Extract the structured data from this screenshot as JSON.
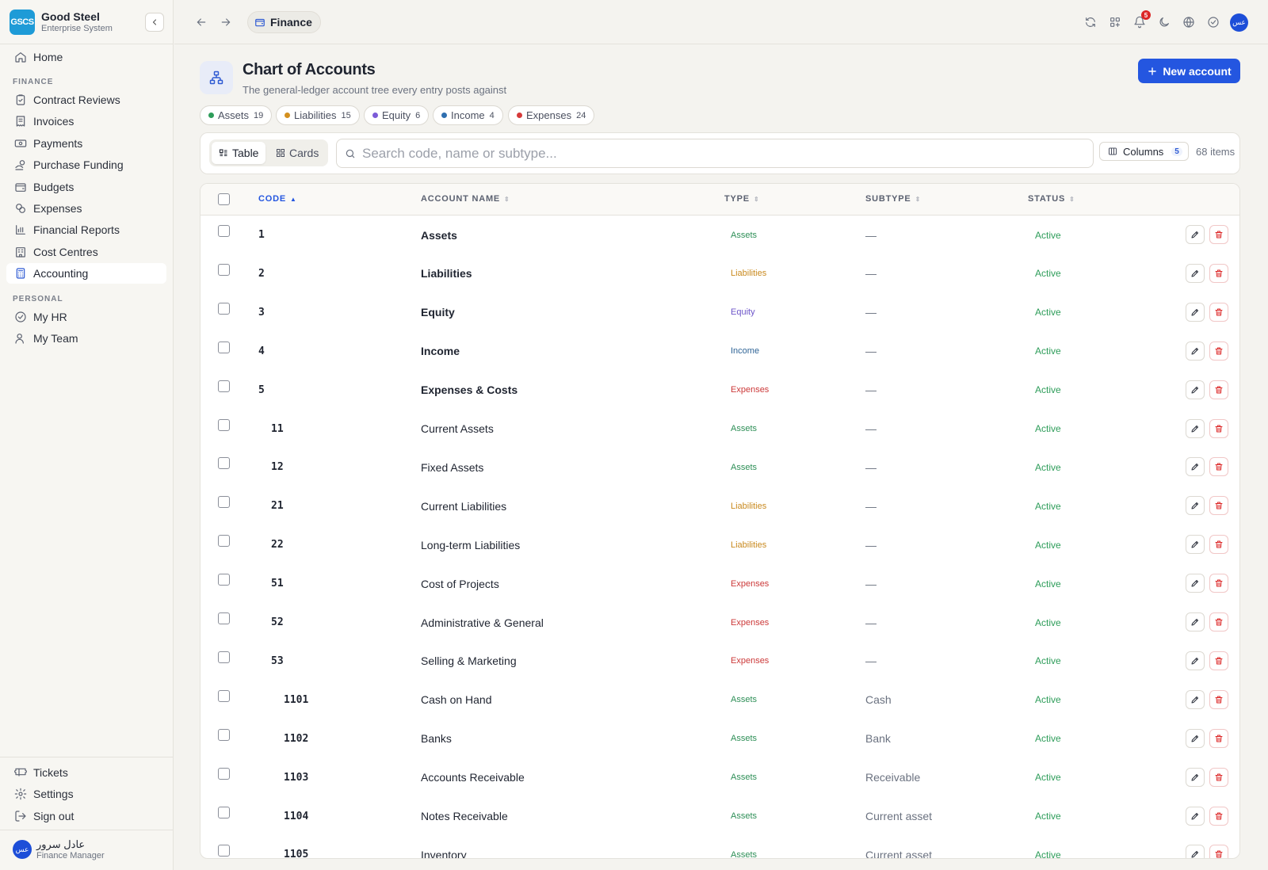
{
  "brand": {
    "logo": "GSCS",
    "name": "Good Steel",
    "subtitle": "Enterprise System"
  },
  "sidebar": {
    "home": "Home",
    "finance_section": "FINANCE",
    "finance_items": [
      {
        "label": "Contract Reviews",
        "icon": "clipboard-check-icon"
      },
      {
        "label": "Invoices",
        "icon": "receipt-icon"
      },
      {
        "label": "Payments",
        "icon": "banknote-icon"
      },
      {
        "label": "Purchase Funding",
        "icon": "hand-coins-icon"
      },
      {
        "label": "Budgets",
        "icon": "wallet-icon"
      },
      {
        "label": "Expenses",
        "icon": "coins-icon"
      },
      {
        "label": "Financial Reports",
        "icon": "bar-chart-icon"
      },
      {
        "label": "Cost Centres",
        "icon": "building-icon"
      },
      {
        "label": "Accounting",
        "icon": "calculator-icon",
        "active": true
      }
    ],
    "personal_section": "PERSONAL",
    "personal_items": [
      {
        "label": "My HR",
        "icon": "check-circle-icon"
      },
      {
        "label": "My Team",
        "icon": "users-icon"
      }
    ],
    "footer_items": [
      {
        "label": "Tickets",
        "icon": "ticket-icon"
      },
      {
        "label": "Settings",
        "icon": "gear-icon"
      },
      {
        "label": "Sign out",
        "icon": "log-out-icon"
      }
    ],
    "user": {
      "avatar": "عس",
      "name": "عادل سرور",
      "role": "Finance Manager"
    }
  },
  "topbar": {
    "breadcrumb": "Finance",
    "notification_count": "5",
    "avatar": "عس"
  },
  "header": {
    "title": "Chart of Accounts",
    "subtitle": "The general-ledger account tree every entry posts against",
    "new_button": "New account"
  },
  "chips": [
    {
      "label": "Assets",
      "count": "19",
      "color": "#2e9d5a"
    },
    {
      "label": "Liabilities",
      "count": "15",
      "color": "#d4901e"
    },
    {
      "label": "Equity",
      "count": "6",
      "color": "#7c5bd8"
    },
    {
      "label": "Income",
      "count": "4",
      "color": "#2f6fb0"
    },
    {
      "label": "Expenses",
      "count": "24",
      "color": "#d63a3a"
    }
  ],
  "toolbar": {
    "view_table": "Table",
    "view_cards": "Cards",
    "search_placeholder": "Search code, name or subtype...",
    "columns_label": "Columns",
    "columns_count": "5",
    "items_count": "68 items"
  },
  "table": {
    "headers": {
      "code": "CODE",
      "name": "ACCOUNT NAME",
      "type": "TYPE",
      "subtype": "SUBTYPE",
      "status": "STATUS"
    },
    "type_colors": {
      "Assets": "#2e8f57",
      "Liabilities": "#c98a1f",
      "Equity": "#6d55c9",
      "Income": "#2f6496",
      "Expenses": "#cc3a3a"
    },
    "rows": [
      {
        "code": "1",
        "name": "Assets",
        "type": "Assets",
        "subtype": "—",
        "status": "Active",
        "level": 0
      },
      {
        "code": "2",
        "name": "Liabilities",
        "type": "Liabilities",
        "subtype": "—",
        "status": "Active",
        "level": 0
      },
      {
        "code": "3",
        "name": "Equity",
        "type": "Equity",
        "subtype": "—",
        "status": "Active",
        "level": 0
      },
      {
        "code": "4",
        "name": "Income",
        "type": "Income",
        "subtype": "—",
        "status": "Active",
        "level": 0
      },
      {
        "code": "5",
        "name": "Expenses & Costs",
        "type": "Expenses",
        "subtype": "—",
        "status": "Active",
        "level": 0
      },
      {
        "code": "11",
        "name": "Current Assets",
        "type": "Assets",
        "subtype": "—",
        "status": "Active",
        "level": 1
      },
      {
        "code": "12",
        "name": "Fixed Assets",
        "type": "Assets",
        "subtype": "—",
        "status": "Active",
        "level": 1
      },
      {
        "code": "21",
        "name": "Current Liabilities",
        "type": "Liabilities",
        "subtype": "—",
        "status": "Active",
        "level": 1
      },
      {
        "code": "22",
        "name": "Long-term Liabilities",
        "type": "Liabilities",
        "subtype": "—",
        "status": "Active",
        "level": 1
      },
      {
        "code": "51",
        "name": "Cost of Projects",
        "type": "Expenses",
        "subtype": "—",
        "status": "Active",
        "level": 1
      },
      {
        "code": "52",
        "name": "Administrative & General",
        "type": "Expenses",
        "subtype": "—",
        "status": "Active",
        "level": 1
      },
      {
        "code": "53",
        "name": "Selling & Marketing",
        "type": "Expenses",
        "subtype": "—",
        "status": "Active",
        "level": 1
      },
      {
        "code": "1101",
        "name": "Cash on Hand",
        "type": "Assets",
        "subtype": "Cash",
        "status": "Active",
        "level": 2
      },
      {
        "code": "1102",
        "name": "Banks",
        "type": "Assets",
        "subtype": "Bank",
        "status": "Active",
        "level": 2
      },
      {
        "code": "1103",
        "name": "Accounts Receivable",
        "type": "Assets",
        "subtype": "Receivable",
        "status": "Active",
        "level": 2
      },
      {
        "code": "1104",
        "name": "Notes Receivable",
        "type": "Assets",
        "subtype": "Current asset",
        "status": "Active",
        "level": 2
      },
      {
        "code": "1105",
        "name": "Inventory",
        "type": "Assets",
        "subtype": "Current asset",
        "status": "Active",
        "level": 2
      }
    ]
  }
}
